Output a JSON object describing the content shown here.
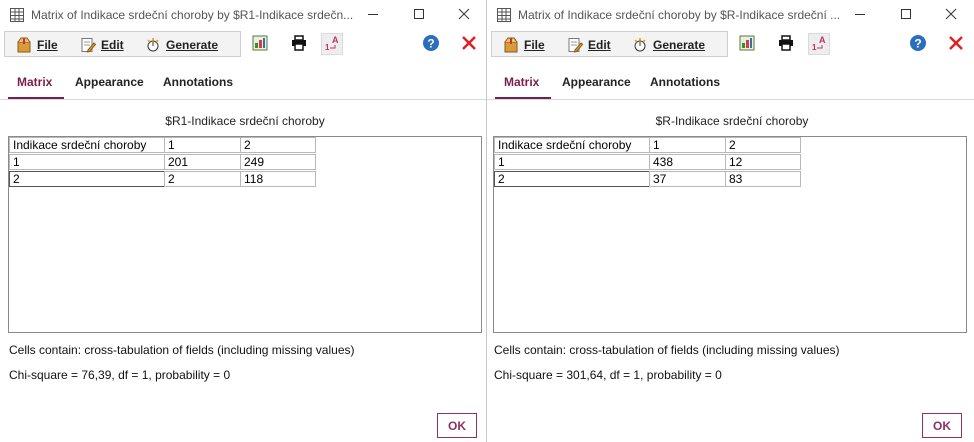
{
  "windows": [
    {
      "title": "Matrix of Indikace srdeční choroby by $R1-Indikace srdečn...",
      "menu": {
        "file": "File",
        "edit": "Edit",
        "generate": "Generate"
      },
      "tabs": [
        "Matrix",
        "Appearance",
        "Annotations"
      ],
      "caption": "$R1-Indikace srdeční choroby",
      "table": {
        "header": [
          "Indikace srdeční choroby",
          "1",
          "2"
        ],
        "rows": [
          [
            "1",
            "201",
            "249"
          ],
          [
            "2",
            "2",
            "118"
          ]
        ]
      },
      "cells_contain": "Cells contain: cross-tabulation of fields (including missing values)",
      "chi_square": "Chi-square = 76,39, df = 1, probability = 0",
      "ok_label": "OK"
    },
    {
      "title": "Matrix of Indikace srdeční choroby by $R-Indikace srdeční ...",
      "menu": {
        "file": "File",
        "edit": "Edit",
        "generate": "Generate"
      },
      "tabs": [
        "Matrix",
        "Appearance",
        "Annotations"
      ],
      "caption": "$R-Indikace srdeční choroby",
      "table": {
        "header": [
          "Indikace srdeční choroby",
          "1",
          "2"
        ],
        "rows": [
          [
            "1",
            "438",
            "12"
          ],
          [
            "2",
            "37",
            "83"
          ]
        ]
      },
      "cells_contain": "Cells contain: cross-tabulation of fields (including missing values)",
      "chi_square": "Chi-square = 301,64, df = 1, probability = 0",
      "ok_label": "OK"
    }
  ],
  "colors": {
    "accent": "#7a1f4a",
    "ok_border": "#8a3462",
    "help": "#2a6fbf",
    "close_red": "#e02020"
  },
  "icons": [
    "table-icon",
    "package-icon",
    "edit-icon",
    "generate-icon",
    "graph-icon",
    "print-icon",
    "format-icon",
    "help-icon",
    "close-red-icon"
  ]
}
